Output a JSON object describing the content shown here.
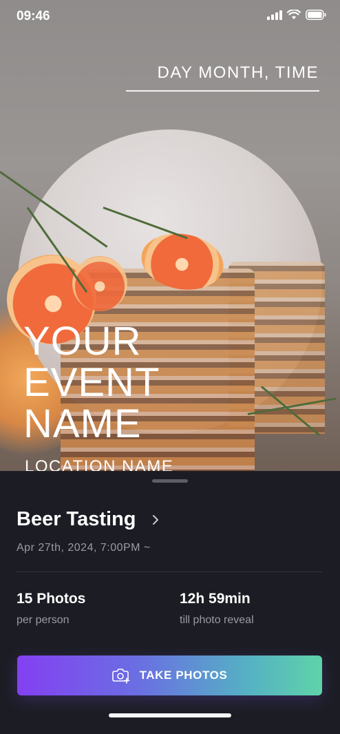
{
  "status_bar": {
    "time": "09:46"
  },
  "hero": {
    "date_placeholder": "DAY MONTH, TIME",
    "event_name_line1": "YOUR",
    "event_name_line2": "EVENT",
    "event_name_line3": "NAME",
    "location_placeholder": "LOCATION NAME"
  },
  "event": {
    "title": "Beer Tasting",
    "datetime": "Apr 27th, 2024, 7:00PM  ~"
  },
  "stats": [
    {
      "value": "15 Photos",
      "label": "per person"
    },
    {
      "value": "12h 59min",
      "label": "till photo reveal"
    }
  ],
  "cta": {
    "label": "TAKE PHOTOS",
    "icon": "camera-plus-icon"
  },
  "colors": {
    "sheet_bg": "#1c1d24",
    "cta_gradient_start": "#8440f2",
    "cta_gradient_end": "#5fd3a8"
  }
}
